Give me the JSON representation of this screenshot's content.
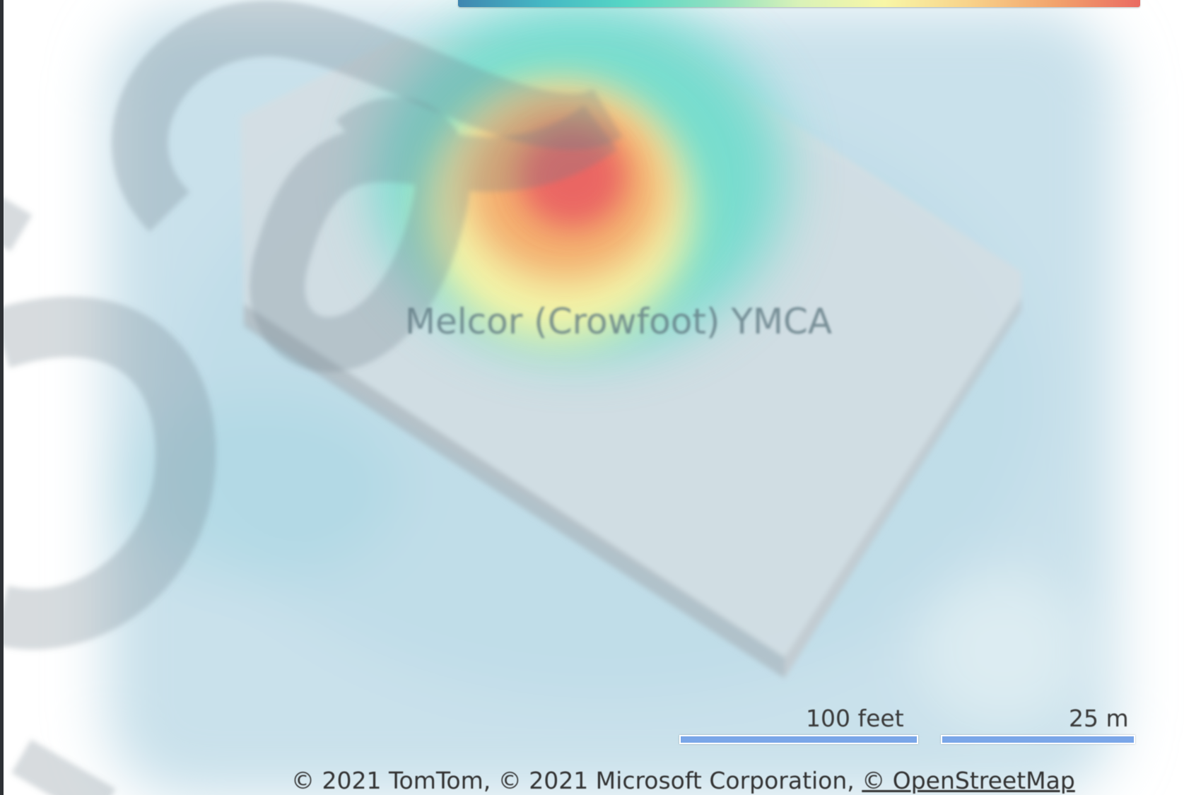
{
  "map": {
    "place_label": "Melcor (Crowfoot) YMCA",
    "heatmap_legend": {
      "gradient_colors": [
        "#3f86b0",
        "#45b8c4",
        "#56d7c5",
        "#8ee0c1",
        "#d9f2b8",
        "#f8f6a6",
        "#f8d28a",
        "#f2a36c",
        "#ea6b62"
      ]
    },
    "scale": {
      "imperial_label": "100 feet",
      "metric_label": "25 m",
      "bar_color": "#7aa6e8"
    },
    "attribution": {
      "text": "© 2021 TomTom, © 2021 Microsoft Corporation, ",
      "osm_link": "© OpenStreetMap"
    },
    "heat_colors": {
      "hot": "#ea6464",
      "warm": "#f4a86a",
      "mid": "#faf5a6",
      "cool": "#66dccb",
      "base": "#bcdae6"
    },
    "watermark": "logo"
  }
}
